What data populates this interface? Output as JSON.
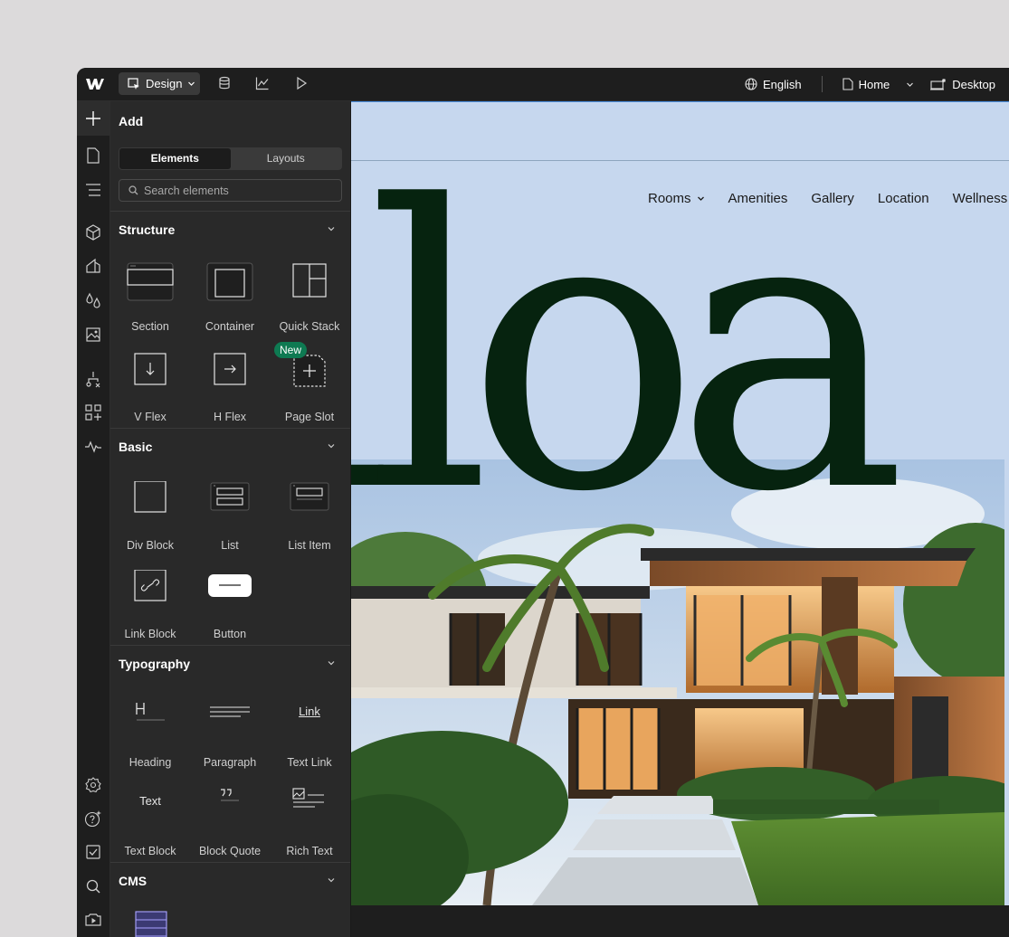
{
  "topbar": {
    "mode_label": "Design",
    "language": "English",
    "page": "Home",
    "breakpoint": "Desktop"
  },
  "panel": {
    "title": "Add",
    "tabs": [
      "Elements",
      "Layouts"
    ],
    "active_tab": "Elements",
    "search_placeholder": "Search elements"
  },
  "sections": {
    "structure": {
      "title": "Structure",
      "items": [
        "Section",
        "Container",
        "Quick Stack",
        "V Flex",
        "H Flex",
        "Page Slot"
      ],
      "badge": "New"
    },
    "basic": {
      "title": "Basic",
      "items": [
        "Div Block",
        "List",
        "List Item",
        "Link Block",
        "Button"
      ]
    },
    "typography": {
      "title": "Typography",
      "items": [
        "Heading",
        "Paragraph",
        "Text Link",
        "Text Block",
        "Block Quote",
        "Rich Text"
      ],
      "text_link_glyph": "Link",
      "text_block_glyph": "Text"
    },
    "cms": {
      "title": "CMS"
    }
  },
  "canvas": {
    "nav": [
      "Rooms",
      "Amenities",
      "Gallery",
      "Location",
      "Wellness"
    ],
    "hero_text": "iloa"
  },
  "colors": {
    "app_bg": "#1e1e1e",
    "panel_bg": "#292929",
    "canvas_bg": "#c6d7ee",
    "hero_text": "#06230f",
    "badge": "#0e7a52",
    "selection": "#4a90e2"
  }
}
